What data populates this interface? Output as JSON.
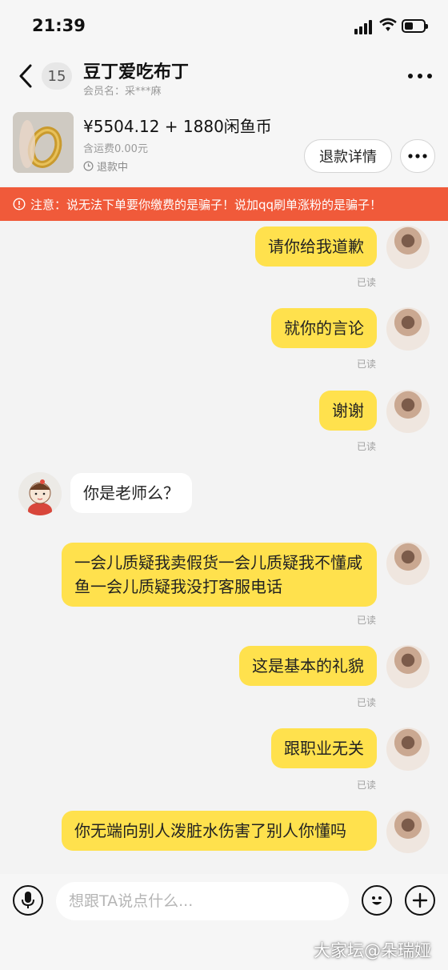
{
  "status_bar": {
    "time": "21:39"
  },
  "header": {
    "unread_count": "15",
    "title": "豆丁爱吃布丁",
    "member_name": "会员名：采***麻"
  },
  "order": {
    "price": "¥5504.12 + 1880闲鱼币",
    "shipping": "含运费0.00元",
    "status": "退款中",
    "refund_button": "退款详情"
  },
  "warning": {
    "text": "注意：说无法下单要你缴费的是骗子！说加qq刷单涨粉的是骗子！"
  },
  "messages": [
    {
      "sender": "me",
      "text": "请你给我道歉",
      "read_label": "已读"
    },
    {
      "sender": "me",
      "text": "就你的言论",
      "read_label": "已读"
    },
    {
      "sender": "me",
      "text": "谢谢",
      "read_label": "已读"
    },
    {
      "sender": "them",
      "text": "你是老师么？"
    },
    {
      "sender": "me",
      "text": "一会儿质疑我卖假货一会儿质疑我不懂咸鱼一会儿质疑我没打客服电话",
      "read_label": "已读"
    },
    {
      "sender": "me",
      "text": "这是基本的礼貌",
      "read_label": "已读"
    },
    {
      "sender": "me",
      "text": "跟职业无关",
      "read_label": "已读"
    },
    {
      "sender": "me",
      "text": "你无端向别人泼脏水伤害了别人你懂吗"
    }
  ],
  "input": {
    "placeholder": "想跟TA说点什么..."
  },
  "watermark": "大家坛@朵瑞娅",
  "colors": {
    "bubble_mine": "#ffe14d",
    "warning_bg": "#f05a3a"
  }
}
